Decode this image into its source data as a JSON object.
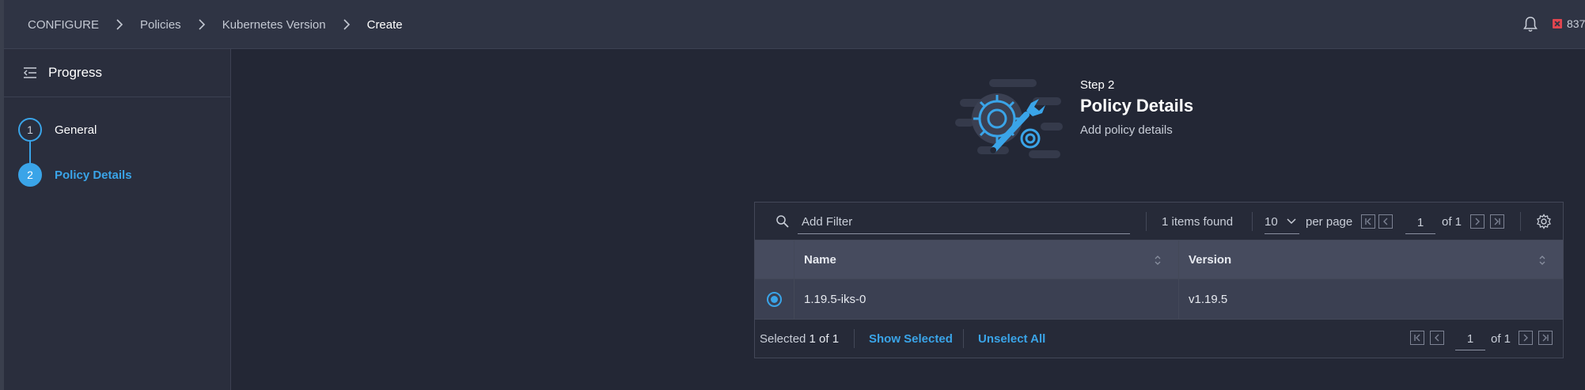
{
  "breadcrumb": [
    "CONFIGURE",
    "Policies",
    "Kubernetes Version",
    "Create"
  ],
  "header_right": {
    "alarm_count": "837"
  },
  "sidebar": {
    "title": "Progress",
    "steps": [
      {
        "number": "1",
        "label": "General",
        "active": false
      },
      {
        "number": "2",
        "label": "Policy Details",
        "active": true
      }
    ]
  },
  "main": {
    "step_label": "Step 2",
    "title": "Policy Details",
    "subtitle": "Add policy details"
  },
  "table": {
    "filter_placeholder": "Add Filter",
    "items_found": "1 items found",
    "per_page_value": "10",
    "per_page_label": "per page",
    "page": "1",
    "of_pages": "of 1",
    "columns": [
      "Name",
      "Version"
    ],
    "rows": [
      {
        "name": "1.19.5-iks-0",
        "version": "v1.19.5",
        "selected": true
      }
    ],
    "footer": {
      "selected_prefix": "Selected",
      "selected_count": "1 of 1",
      "show_selected": "Show Selected",
      "unselect_all": "Unselect All",
      "page": "1",
      "of_pages": "of 1"
    }
  },
  "colors": {
    "accent": "#3aa4e8",
    "background": "#232735",
    "alarm": "#e0454f"
  }
}
